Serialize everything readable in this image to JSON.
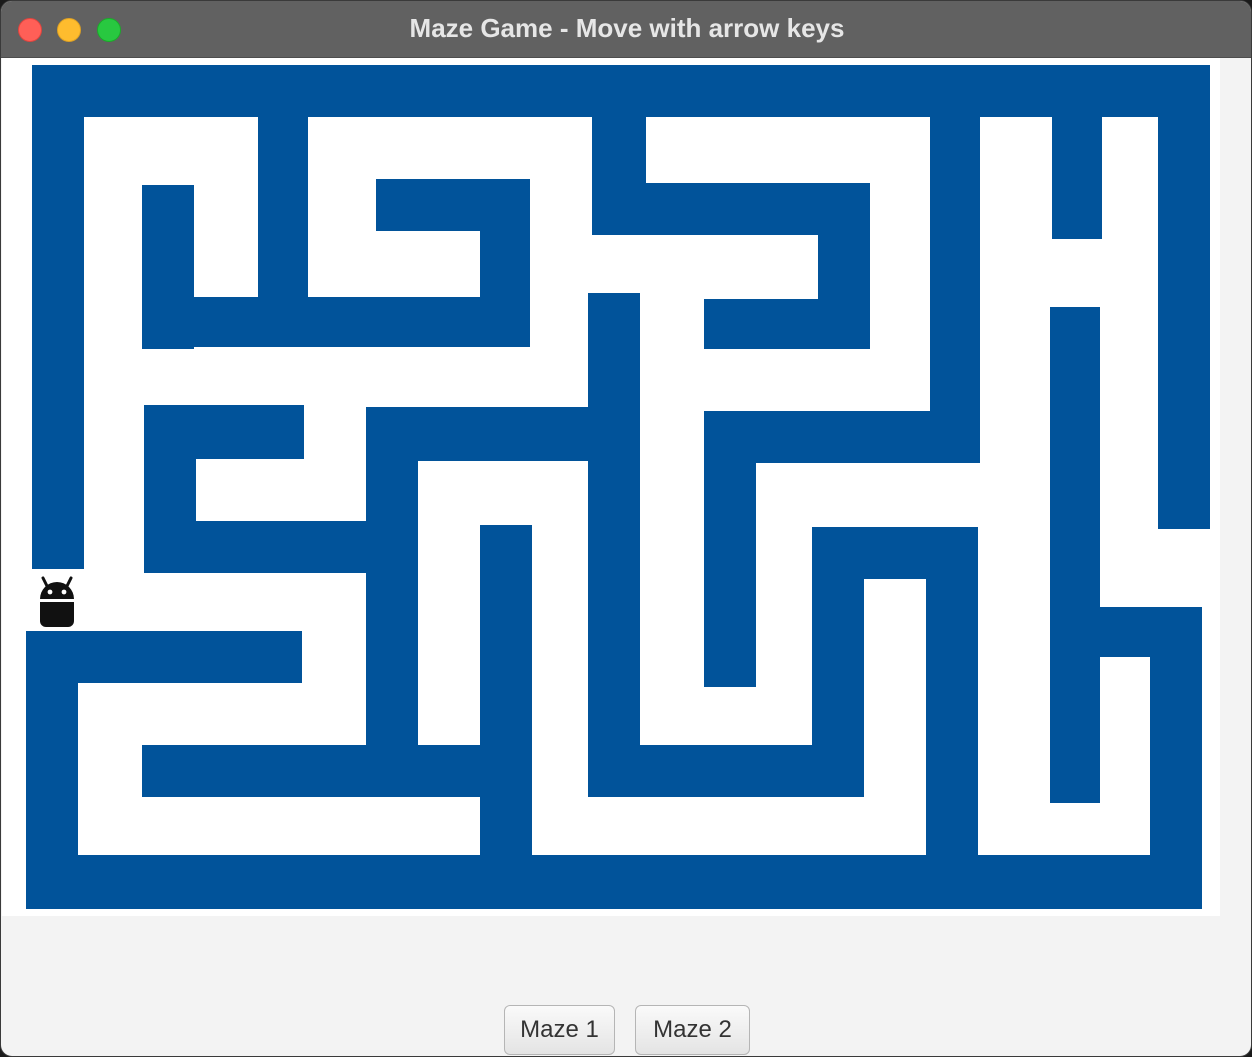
{
  "window": {
    "title": "Maze Game - Move with arrow keys"
  },
  "maze": {
    "wall_color": "#01539a",
    "path_color": "#ffffff",
    "player_icon": "android-robot-icon"
  },
  "controls": {
    "maze1_label": "Maze 1",
    "maze2_label": "Maze 2"
  }
}
